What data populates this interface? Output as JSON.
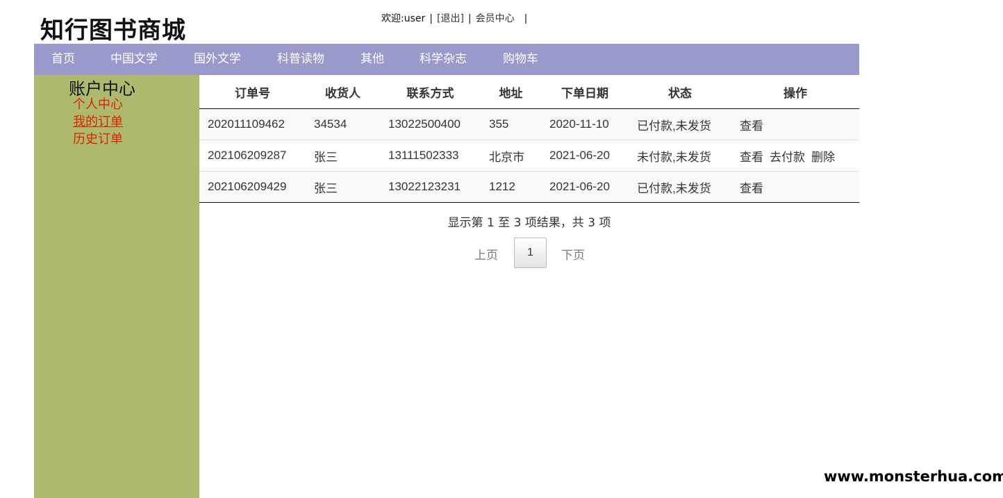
{
  "site": {
    "title": "知行图书商城"
  },
  "user_bar": {
    "welcome": "欢迎:user",
    "separator": "|",
    "logout": "[退出]",
    "member_center": "会员中心"
  },
  "nav": {
    "items": [
      {
        "label": "首页"
      },
      {
        "label": "中国文学"
      },
      {
        "label": "国外文学"
      },
      {
        "label": "科普读物"
      },
      {
        "label": "其他"
      },
      {
        "label": "科学杂志"
      },
      {
        "label": "购物车"
      }
    ]
  },
  "sidebar": {
    "title": "账户中心",
    "links": [
      {
        "label": "个人中心"
      },
      {
        "label": "我的订单"
      },
      {
        "label": "历史订单"
      }
    ]
  },
  "orders": {
    "columns": [
      "订单号",
      "收货人",
      "联系方式",
      "地址",
      "下单日期",
      "状态",
      "操作"
    ],
    "rows": [
      {
        "order_no": "202011109462",
        "receiver": "34534",
        "phone": "13022500400",
        "address": "355",
        "date": "2020-11-10",
        "status": "已付款,未发货",
        "actions": [
          "查看"
        ]
      },
      {
        "order_no": "202106209287",
        "receiver": "张三",
        "phone": "13111502333",
        "address": "北京市",
        "date": "2021-06-20",
        "status": "未付款,未发货",
        "actions": [
          "查看",
          "去付款",
          "删除"
        ]
      },
      {
        "order_no": "202106209429",
        "receiver": "张三",
        "phone": "13022123231",
        "address": "1212",
        "date": "2021-06-20",
        "status": "已付款,未发货",
        "actions": [
          "查看"
        ]
      }
    ]
  },
  "pagination": {
    "info": "显示第 1 至 3 项结果，共 3 项",
    "prev": "上页",
    "current_page": "1",
    "next": "下页"
  },
  "watermark": "www.monsterhua.com",
  "colors": {
    "nav_bg": "#9999cc",
    "sidebar_bg": "#adba6e",
    "sidebar_link": "#dd2200"
  }
}
